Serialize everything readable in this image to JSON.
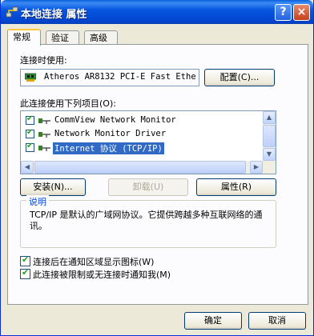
{
  "window": {
    "title": "本地连接 属性",
    "help_glyph": "?",
    "close_glyph": "×"
  },
  "tabs": [
    {
      "label": "常规",
      "active": true
    },
    {
      "label": "验证",
      "active": false
    },
    {
      "label": "高级",
      "active": false
    }
  ],
  "connect_using": {
    "label": "连接时使用:",
    "adapter_name": "Atheros AR8132 PCI-E Fast Ethe",
    "configure_button": "配置(C)..."
  },
  "components": {
    "label": "此连接使用下列项目(O):",
    "items": [
      {
        "name": "CommView Network Monitor",
        "checked": true,
        "selected": false
      },
      {
        "name": "Network Monitor Driver",
        "checked": true,
        "selected": false
      },
      {
        "name": "Internet 协议 (TCP/IP)",
        "checked": true,
        "selected": true
      }
    ]
  },
  "actions": {
    "install": "安装(N)...",
    "uninstall": "卸载(U)",
    "properties": "属性(R)"
  },
  "description": {
    "title": "说明",
    "text": "TCP/IP 是默认的广域网协议。它提供跨越多种互联网络的通讯。"
  },
  "options": {
    "show_icon": {
      "label": "连接后在通知区域显示图标(W)",
      "checked": true
    },
    "notify_limited": {
      "label": "此连接被限制或无连接时通知我(M)",
      "checked": true
    }
  },
  "footer": {
    "ok": "确定",
    "cancel": "取消"
  },
  "colors": {
    "titlebar": "#0245d1",
    "selection": "#316ac5",
    "dialog_bg": "#ece9d8",
    "group_title": "#0046d5"
  }
}
